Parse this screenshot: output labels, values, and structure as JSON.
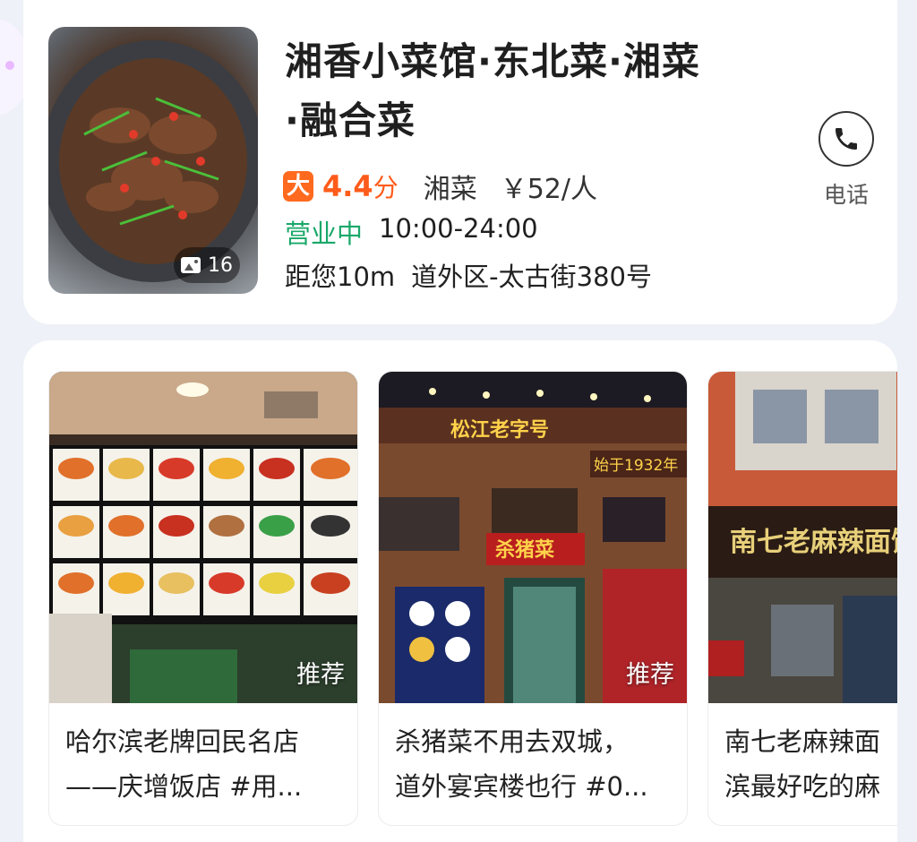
{
  "shop": {
    "name_line1": "湘香小菜馆·东北菜·湘菜",
    "name_line2": "·融合菜",
    "photo_count": "16",
    "score": "4.4",
    "score_unit": "分",
    "cuisine": "湘菜",
    "price": "￥52/人",
    "status": "营业中",
    "hours": "10:00-24:00",
    "distance": "距您10m",
    "address": "道外区-太古街380号",
    "phone_label": "电话",
    "rating_logo_char": "大"
  },
  "recommendations": [
    {
      "tag": "推荐",
      "title_line1": "哈尔滨老牌回民名店",
      "title_line2": "——庆增饭店 #用..."
    },
    {
      "tag": "推荐",
      "title_line1": "杀猪菜不用去双城，",
      "title_line2": "道外宴宾楼也行 #0..."
    },
    {
      "tag": "",
      "title_line1": "南七老麻辣面",
      "title_line2": "滨最好吃的麻"
    }
  ],
  "image_signs": {
    "rec2_sign_top": "松江老字号",
    "rec2_sign_year": "始于1932年",
    "rec2_sign_name": "杀猪菜",
    "rec3_sign": "南七老麻辣面馆"
  },
  "colors": {
    "accent_orange": "#ff5b1a",
    "open_green": "#1aa86a",
    "page_bg": "#eef1f7"
  },
  "icons": [
    "photo-icon",
    "rating-logo-icon",
    "phone-icon"
  ]
}
